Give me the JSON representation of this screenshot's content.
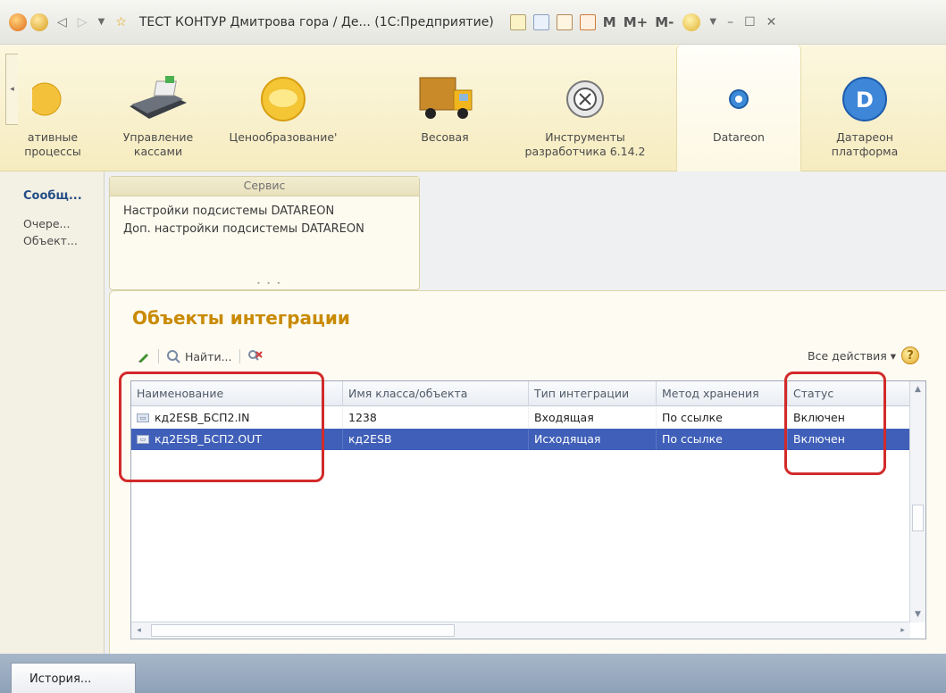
{
  "window": {
    "title": "ТЕСТ КОНТУР Дмитрова гора / Де... (1С:Предприятие)",
    "m_buttons": [
      "M",
      "M+",
      "M-"
    ]
  },
  "sections": [
    {
      "label": "ативные\nпроцессы",
      "icon": "process-icon"
    },
    {
      "label": "Управление\nкассами",
      "icon": "cash-terminal-icon"
    },
    {
      "label": "Ценообразование'",
      "icon": "pricing-coin-icon"
    },
    {
      "label": "Весовая",
      "icon": "truck-icon"
    },
    {
      "label": "Инструменты\nразработчика 6.14.2",
      "icon": "developer-tools-icon"
    },
    {
      "label": "Datareon",
      "icon": "datareon-icon"
    },
    {
      "label": "Датареон\nплатформа",
      "icon": "datareon-platform-icon"
    }
  ],
  "leftnav": {
    "group": "Сообщ...",
    "links": [
      "Очере...",
      "Объект..."
    ]
  },
  "service": {
    "header": "Сервис",
    "items": [
      "Настройки подсистемы DATAREON",
      "Доп. настройки подсистемы DATAREON"
    ]
  },
  "form": {
    "title": "Объекты интеграции",
    "find_label": "Найти...",
    "all_actions_label": "Все действия ▾",
    "help_label": "?"
  },
  "table": {
    "columns": [
      "Наименование",
      "Имя класса/объекта",
      "Тип интеграции",
      "Метод хранения",
      "Статус"
    ],
    "rows": [
      {
        "name": "кд2ESB_БСП2.IN",
        "class": "1238",
        "type": "Входящая",
        "method": "По ссылке",
        "status": "Включен",
        "selected": false
      },
      {
        "name": "кд2ESB_БСП2.OUT",
        "class": "кд2ESB",
        "type": "Исходящая",
        "method": "По ссылке",
        "status": "Включен",
        "selected": true
      }
    ]
  },
  "bottom": {
    "history_label": "История..."
  },
  "colors": {
    "accent_title": "#c98a00",
    "selection": "#3f5fb8",
    "highlight": "#d22a2a"
  }
}
